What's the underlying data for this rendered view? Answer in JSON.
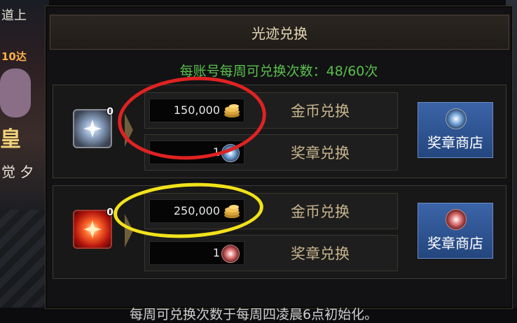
{
  "background": {
    "left_texts": [
      "道上",
      "10达",
      "皇",
      "觉 夕"
    ]
  },
  "panel": {
    "title": "光迹兑换",
    "subtitle": "每账号每周可兑换次数：48/60次",
    "footer": "每周可兑换次数于每周四凌晨6点初始化。"
  },
  "rows": [
    {
      "item_icon": "silver-light-orb-icon",
      "item_count": "0",
      "gold_exchange": {
        "price": "150,000",
        "icon": "gold-coin-icon",
        "label": "金币兑换"
      },
      "medal_exchange": {
        "price": "1",
        "icon": "blue-medal-icon",
        "label": "奖章兑换"
      },
      "shop_button": {
        "label": "奖章商店",
        "icon": "blue-medal-icon"
      }
    },
    {
      "item_icon": "red-flame-orb-icon",
      "item_count": "0",
      "gold_exchange": {
        "price": "250,000",
        "icon": "gold-coin-icon",
        "label": "金币兑换"
      },
      "medal_exchange": {
        "price": "1",
        "icon": "red-medal-icon",
        "label": "奖章兑换"
      },
      "shop_button": {
        "label": "奖章商店",
        "icon": "red-medal-icon"
      }
    }
  ],
  "colors": {
    "subtitle_green": "#59c04c",
    "highlight_red": "#e02222",
    "highlight_yellow": "#f2e21a",
    "shop_blue": "#2f5596"
  }
}
